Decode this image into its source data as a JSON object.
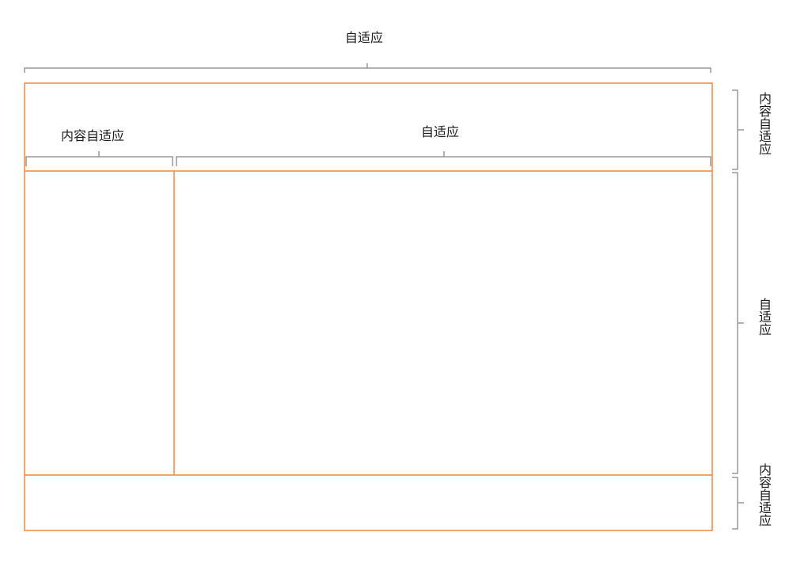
{
  "labels": {
    "top_width": "自适应",
    "sidebar_width": "内容自适应",
    "main_width": "自适应",
    "header_height": "内容自适应",
    "body_height": "自适应",
    "footer_height": "内容自适应"
  },
  "colors": {
    "layout_border": "#f0883e",
    "dimension_bracket": "#9a9a9a",
    "text": "#1a1a1a"
  }
}
